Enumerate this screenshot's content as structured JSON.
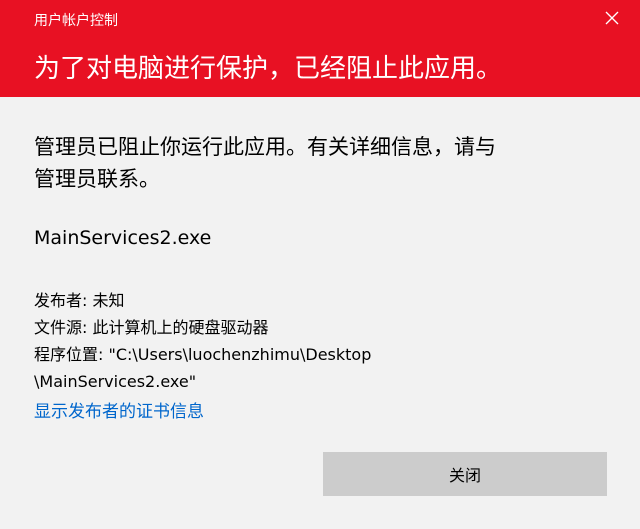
{
  "window": {
    "title": "用户帐户控制",
    "close_icon": "close-icon"
  },
  "header": {
    "headline": "为了对电脑进行保护，已经阻止此应用。",
    "background_color": "#e81123"
  },
  "message": {
    "text": "管理员已阻止你运行此应用。有关详细信息，请与管理员联系。"
  },
  "app": {
    "name": "MainServices2.exe"
  },
  "details": {
    "publisher": "发布者: 未知",
    "file_source": "文件源: 此计算机上的硬盘驱动器",
    "program_location_line1": "程序位置: \"C:\\Users\\luochenzhimu\\Desktop",
    "program_location_line2": "\\MainServices2.exe\""
  },
  "links": {
    "show_certificate": "显示发布者的证书信息",
    "link_color": "#0066cc"
  },
  "buttons": {
    "close_label": "关闭"
  }
}
